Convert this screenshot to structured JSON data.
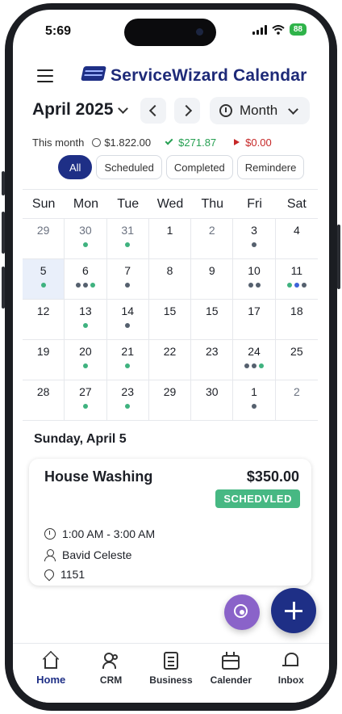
{
  "status_bar": {
    "time": "5:69",
    "battery": "88"
  },
  "header": {
    "title": "ServiceWizard Calendar"
  },
  "month_nav": {
    "month_label": "April 2025",
    "view_label": "Month"
  },
  "summary": {
    "label": "This month",
    "total": "$1.822.00",
    "paid": "$271.87",
    "unpaid": "$0.00"
  },
  "filters": [
    "All",
    "Scheduled",
    "Completed",
    "Remindere"
  ],
  "calendar": {
    "weekdays": [
      "Sun",
      "Mon",
      "Tue",
      "Wed",
      "Thu",
      "Fri",
      "Sat"
    ],
    "days": [
      {
        "d": "29",
        "muted": true,
        "dots": []
      },
      {
        "d": "30",
        "muted": true,
        "dots": [
          "green"
        ]
      },
      {
        "d": "31",
        "muted": true,
        "dots": [
          "green"
        ]
      },
      {
        "d": "1",
        "dots": []
      },
      {
        "d": "2",
        "muted": true,
        "dots": []
      },
      {
        "d": "3",
        "dots": [
          "gray"
        ]
      },
      {
        "d": "4",
        "dots": []
      },
      {
        "d": "5",
        "selected": true,
        "dots": [
          "green"
        ]
      },
      {
        "d": "6",
        "dots": [
          "gray",
          "gray",
          "green"
        ]
      },
      {
        "d": "7",
        "dots": [
          "gray"
        ]
      },
      {
        "d": "8",
        "dots": []
      },
      {
        "d": "9",
        "dots": []
      },
      {
        "d": "10",
        "dots": [
          "gray",
          "gray"
        ]
      },
      {
        "d": "11",
        "dots": [
          "green",
          "blue",
          "gray"
        ]
      },
      {
        "d": "12",
        "dots": []
      },
      {
        "d": "13",
        "dots": [
          "green"
        ]
      },
      {
        "d": "14",
        "dots": [
          "gray"
        ]
      },
      {
        "d": "15",
        "dots": []
      },
      {
        "d": "15",
        "dots": []
      },
      {
        "d": "17",
        "dots": []
      },
      {
        "d": "18",
        "dots": []
      },
      {
        "d": "19",
        "dots": []
      },
      {
        "d": "20",
        "dots": [
          "green"
        ]
      },
      {
        "d": "21",
        "dots": [
          "green"
        ]
      },
      {
        "d": "22",
        "dots": []
      },
      {
        "d": "23",
        "dots": []
      },
      {
        "d": "24",
        "dots": [
          "gray",
          "gray",
          "green"
        ]
      },
      {
        "d": "25",
        "dots": []
      },
      {
        "d": "28",
        "dots": []
      },
      {
        "d": "27",
        "dots": [
          "green"
        ]
      },
      {
        "d": "23",
        "dots": [
          "green"
        ]
      },
      {
        "d": "29",
        "dots": []
      },
      {
        "d": "30",
        "dots": []
      },
      {
        "d": "1",
        "dots": [
          "gray"
        ]
      },
      {
        "d": "2",
        "muted": true,
        "dots": []
      }
    ]
  },
  "day_view": {
    "title": "Sunday, April 5",
    "event": {
      "title": "House Washing",
      "price": "$350.00",
      "status": "SCHEDVLED",
      "time": "1:00 AM - 3:00 AM",
      "customer": "Bavid Celeste",
      "location": "1151"
    }
  },
  "bottom_nav": [
    "Home",
    "CRM",
    "Business",
    "Calender",
    "Inbox"
  ]
}
